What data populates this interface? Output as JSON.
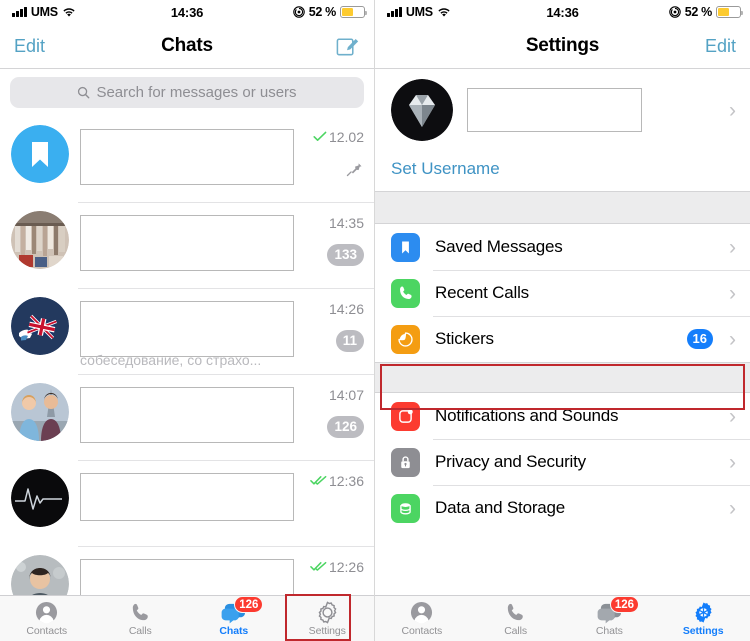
{
  "status_bar": {
    "carrier": "UMS",
    "time": "14:36",
    "battery_percent": "52 %",
    "signal_icon": "signal-bars-icon",
    "wifi_icon": "wifi-icon",
    "rotation_lock_icon": "rotation-lock-icon",
    "battery_icon": "battery-icon",
    "battery_fill_color": "#fdcb30"
  },
  "left_screen": {
    "nav": {
      "left_button": "Edit",
      "title": "Chats",
      "right_icon": "compose-icon"
    },
    "search": {
      "placeholder": "Search for messages or users",
      "icon": "search-icon"
    },
    "chats": [
      {
        "avatar": "saved-messages-bookmark-avatar",
        "name": "",
        "preview": "",
        "time": "12.02",
        "status_icon": "single-check-icon",
        "badge": "",
        "pinned": true,
        "pin_icon": "pin-icon"
      },
      {
        "avatar": "wardrobe-photo-avatar",
        "name": "",
        "preview": "",
        "time": "14:35",
        "status_icon": "",
        "badge": "133",
        "pinned": false
      },
      {
        "avatar": "union-jack-flag-avatar",
        "name": "",
        "preview": "собеседование, со страхо...",
        "time": "14:26",
        "status_icon": "",
        "badge": "11",
        "pinned": false
      },
      {
        "avatar": "couple-photo-avatar",
        "name": "",
        "preview": "",
        "time": "14:07",
        "status_icon": "",
        "badge": "126",
        "pinned": false
      },
      {
        "avatar": "heartbeat-waveform-avatar",
        "name": "",
        "preview": "",
        "time": "12:36",
        "status_icon": "double-check-icon",
        "badge": "",
        "pinned": false
      },
      {
        "avatar": "woman-portrait-avatar",
        "name": "",
        "preview": "",
        "time": "12:26",
        "status_icon": "double-check-icon",
        "badge": "",
        "pinned": false
      }
    ],
    "tabs": [
      {
        "label": "Contacts",
        "icon": "contacts-icon",
        "active": false,
        "badge": ""
      },
      {
        "label": "Calls",
        "icon": "calls-icon",
        "active": false,
        "badge": ""
      },
      {
        "label": "Chats",
        "icon": "chats-icon",
        "active": true,
        "badge": "126"
      },
      {
        "label": "Settings",
        "icon": "settings-gear-icon",
        "active": false,
        "badge": ""
      }
    ],
    "highlight": {
      "target": "settings-tab",
      "color": "#c0282d"
    }
  },
  "right_screen": {
    "nav": {
      "title": "Settings",
      "right_button": "Edit"
    },
    "profile": {
      "avatar": "diamond-photo-avatar",
      "name": "",
      "chevron": "›",
      "set_username_label": "Set Username"
    },
    "settings_groups": [
      {
        "items": [
          {
            "label": "Saved Messages",
            "icon": "bookmark-icon",
            "icon_color": "#2c8cf0",
            "badge": "",
            "chevron": "›",
            "highlighted": false
          },
          {
            "label": "Recent Calls",
            "icon": "phone-icon",
            "icon_color": "#4cd562",
            "badge": "",
            "chevron": "›",
            "highlighted": false
          },
          {
            "label": "Stickers",
            "icon": "sticker-icon",
            "icon_color": "#f49d12",
            "badge": "16",
            "chevron": "›",
            "highlighted": true
          }
        ]
      },
      {
        "items": [
          {
            "label": "Notifications and Sounds",
            "icon": "notification-bell-icon",
            "icon_color": "#fc3b30",
            "badge": "",
            "chevron": "›",
            "highlighted": false
          },
          {
            "label": "Privacy and Security",
            "icon": "lock-icon",
            "icon_color": "#8e8e93",
            "badge": "",
            "chevron": "›",
            "highlighted": false
          },
          {
            "label": "Data and Storage",
            "icon": "database-icon",
            "icon_color": "#4cd562",
            "badge": "",
            "chevron": "›",
            "highlighted": false
          }
        ]
      }
    ],
    "tabs": [
      {
        "label": "Contacts",
        "icon": "contacts-icon",
        "active": false,
        "badge": ""
      },
      {
        "label": "Calls",
        "icon": "calls-icon",
        "active": false,
        "badge": ""
      },
      {
        "label": "Chats",
        "icon": "chats-icon",
        "active": false,
        "badge": "126"
      },
      {
        "label": "Settings",
        "icon": "settings-gear-icon",
        "active": true,
        "badge": ""
      }
    ],
    "highlight": {
      "target": "stickers-row",
      "color": "#c0282d"
    }
  }
}
